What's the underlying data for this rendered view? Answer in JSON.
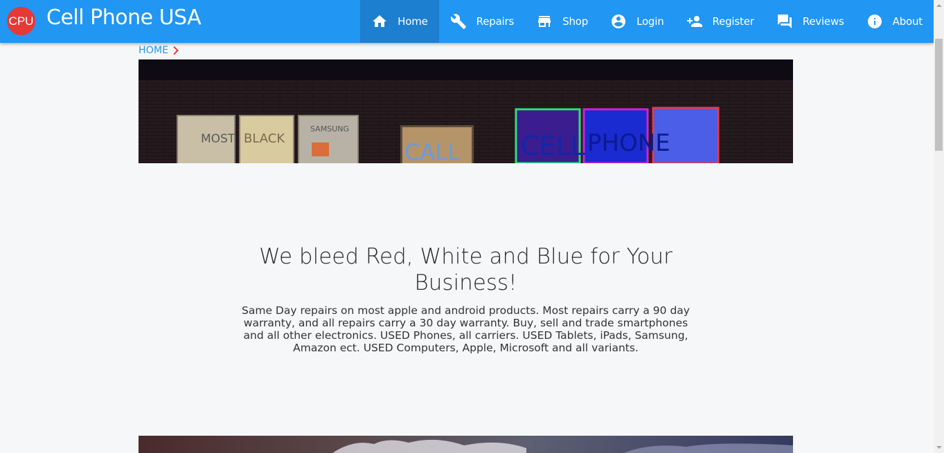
{
  "app": {
    "logo_text": "CPU",
    "brand": "Cell Phone USA",
    "colors": {
      "appbar": "#2196f3",
      "logo": "#e53935",
      "active_nav": "#1c7fcf",
      "link": "#2196f3"
    }
  },
  "nav": {
    "items": [
      {
        "label": "Home",
        "icon": "home-icon",
        "active": true
      },
      {
        "label": "Repairs",
        "icon": "wrench-icon",
        "active": false
      },
      {
        "label": "Shop",
        "icon": "store-icon",
        "active": false
      },
      {
        "label": "Login",
        "icon": "account-circle-icon",
        "active": false
      },
      {
        "label": "Register",
        "icon": "person-add-icon",
        "active": false
      },
      {
        "label": "Reviews",
        "icon": "forum-icon",
        "active": false
      },
      {
        "label": "About",
        "icon": "info-icon",
        "active": false
      }
    ]
  },
  "breadcrumb": {
    "home": "HOME",
    "separator_icon": "chevron-right-icon"
  },
  "hero": {
    "window_signs": [
      "MOST",
      "BLACK",
      "SAMSUNG",
      "CALL",
      "CELL",
      "PHONE"
    ]
  },
  "main": {
    "headline": "We bleed Red, White and Blue for Your Business!",
    "description": "Same Day repairs on most apple and android products. Most repairs carry a 90 day warranty, and all repairs carry a 30 day warranty. Buy, sell and trade smartphones and all other electronics. USED Phones, all carriers. USED Tablets, iPads, Samsung, Amazon ect. USED Computers, Apple, Microsoft and all variants."
  }
}
